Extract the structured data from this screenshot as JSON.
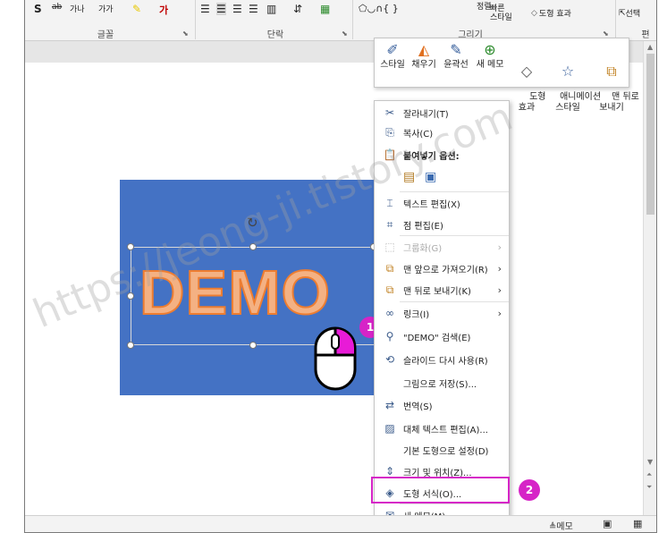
{
  "ribbon": {
    "groups": [
      {
        "label": "글꼴"
      },
      {
        "label": "단락"
      },
      {
        "label": "그리기"
      },
      {
        "label": "편"
      }
    ],
    "font_buttons": [
      "S",
      "ab",
      "가나",
      "가가",
      "가"
    ],
    "quick_style_top": "정렬",
    "quick_style": "빠른\n스타일",
    "shape_effect": "도형 효과",
    "select": "선택"
  },
  "mini_toolbar": {
    "items": [
      {
        "label": "스타일",
        "icon": "style-icon"
      },
      {
        "label": "채우기",
        "icon": "fill-icon"
      },
      {
        "label": "윤곽선",
        "icon": "outline-icon"
      },
      {
        "label": "새 메모",
        "icon": "new-comment-icon"
      },
      {
        "label": "도형\n효과",
        "icon": "shape-effect-icon"
      },
      {
        "label": "애니메이션\n스타일",
        "icon": "animation-icon"
      },
      {
        "label": "맨 뒤로\n보내기",
        "icon": "send-back-icon"
      }
    ]
  },
  "slide": {
    "text": "DEMO",
    "watermark": "https://jeong-ji.tistory.com",
    "fill_color": "#4472c4",
    "text_color": "#f4b183"
  },
  "context_menu": {
    "items": [
      {
        "label": "잘라내기(T)",
        "icon": "scissors-icon",
        "disabled": false,
        "submenu": false
      },
      {
        "label": "복사(C)",
        "icon": "copy-icon",
        "disabled": false,
        "submenu": false
      },
      {
        "label": "붙여넣기 옵션:",
        "icon": "paste-icon",
        "disabled": false,
        "submenu": false,
        "bold": true
      },
      {
        "label": "텍스트 편집(X)",
        "icon": "text-edit-icon",
        "disabled": false,
        "submenu": false
      },
      {
        "label": "점 편집(E)",
        "icon": "edit-points-icon",
        "disabled": false,
        "submenu": false
      },
      {
        "label": "그룹화(G)",
        "icon": "group-icon",
        "disabled": true,
        "submenu": true
      },
      {
        "label": "맨 앞으로 가져오기(R)",
        "icon": "bring-front-icon",
        "disabled": false,
        "submenu": true
      },
      {
        "label": "맨 뒤로 보내기(K)",
        "icon": "send-back-icon",
        "disabled": false,
        "submenu": true
      },
      {
        "label": "링크(I)",
        "icon": "link-icon",
        "disabled": false,
        "submenu": true
      },
      {
        "label": "\"DEMO\" 검색(E)",
        "icon": "search-icon",
        "disabled": false,
        "submenu": false
      },
      {
        "label": "슬라이드 다시 사용(R)",
        "icon": "reuse-slides-icon",
        "disabled": false,
        "submenu": false
      },
      {
        "label": "그림으로 저장(S)...",
        "icon": "",
        "disabled": false,
        "submenu": false
      },
      {
        "label": "번역(S)",
        "icon": "translate-icon",
        "disabled": false,
        "submenu": false
      },
      {
        "label": "대체 텍스트 편집(A)...",
        "icon": "alt-text-icon",
        "disabled": false,
        "submenu": false
      },
      {
        "label": "기본 도형으로 설정(D)",
        "icon": "",
        "disabled": false,
        "submenu": false
      },
      {
        "label": "크기 및 위치(Z)...",
        "icon": "size-position-icon",
        "disabled": false,
        "submenu": false
      },
      {
        "label": "도형 서식(O)...",
        "icon": "format-shape-icon",
        "disabled": false,
        "submenu": false
      },
      {
        "label": "새 메모(M)",
        "icon": "new-comment-icon",
        "disabled": false,
        "submenu": false
      }
    ]
  },
  "badges": {
    "first": "1",
    "second": "2"
  },
  "status": {
    "notes": "메모"
  },
  "accent": "#d624c7"
}
